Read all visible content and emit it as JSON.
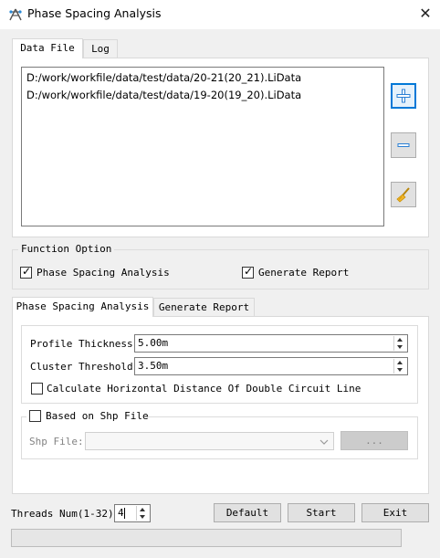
{
  "window": {
    "title": "Phase Spacing Analysis",
    "close_glyph": "✕"
  },
  "top_tabs": [
    {
      "label": "Data File"
    },
    {
      "label": "Log"
    }
  ],
  "files": [
    "D:/work/workfile/data/test/data/20-21(20_21).LiData",
    "D:/work/workfile/data/test/data/19-20(19_20).LiData"
  ],
  "side_buttons": {
    "add_icon": "plus-icon",
    "remove_icon": "minus-icon",
    "clear_icon": "broom-icon"
  },
  "function_option": {
    "title": "Function Option",
    "phase_spacing": {
      "label": "Phase Spacing Analysis",
      "checked": true
    },
    "generate_report": {
      "label": "Generate Report",
      "checked": true
    }
  },
  "sub_tabs": [
    {
      "label": "Phase Spacing Analysis"
    },
    {
      "label": "Generate Report"
    }
  ],
  "params": {
    "profile_thickness": {
      "label": "Profile Thickness:",
      "value": "5.00m"
    },
    "cluster_threshold": {
      "label": "Cluster Threshold:",
      "value": "3.50m"
    },
    "double_circuit": {
      "label": "Calculate Horizontal Distance Of Double Circuit Line",
      "checked": false
    }
  },
  "shp": {
    "title": "Based on Shp File",
    "checked": false,
    "file_label": "Shp File:",
    "file_value": "",
    "browse_label": "..."
  },
  "threads": {
    "label": "Threads Num(1-32):",
    "value": "4"
  },
  "buttons": {
    "default": "Default",
    "start": "Start",
    "exit": "Exit"
  },
  "progress": {
    "fraction": 0
  },
  "colors": {
    "accent": "#0078d7",
    "window_bg": "#f0f0f0"
  }
}
